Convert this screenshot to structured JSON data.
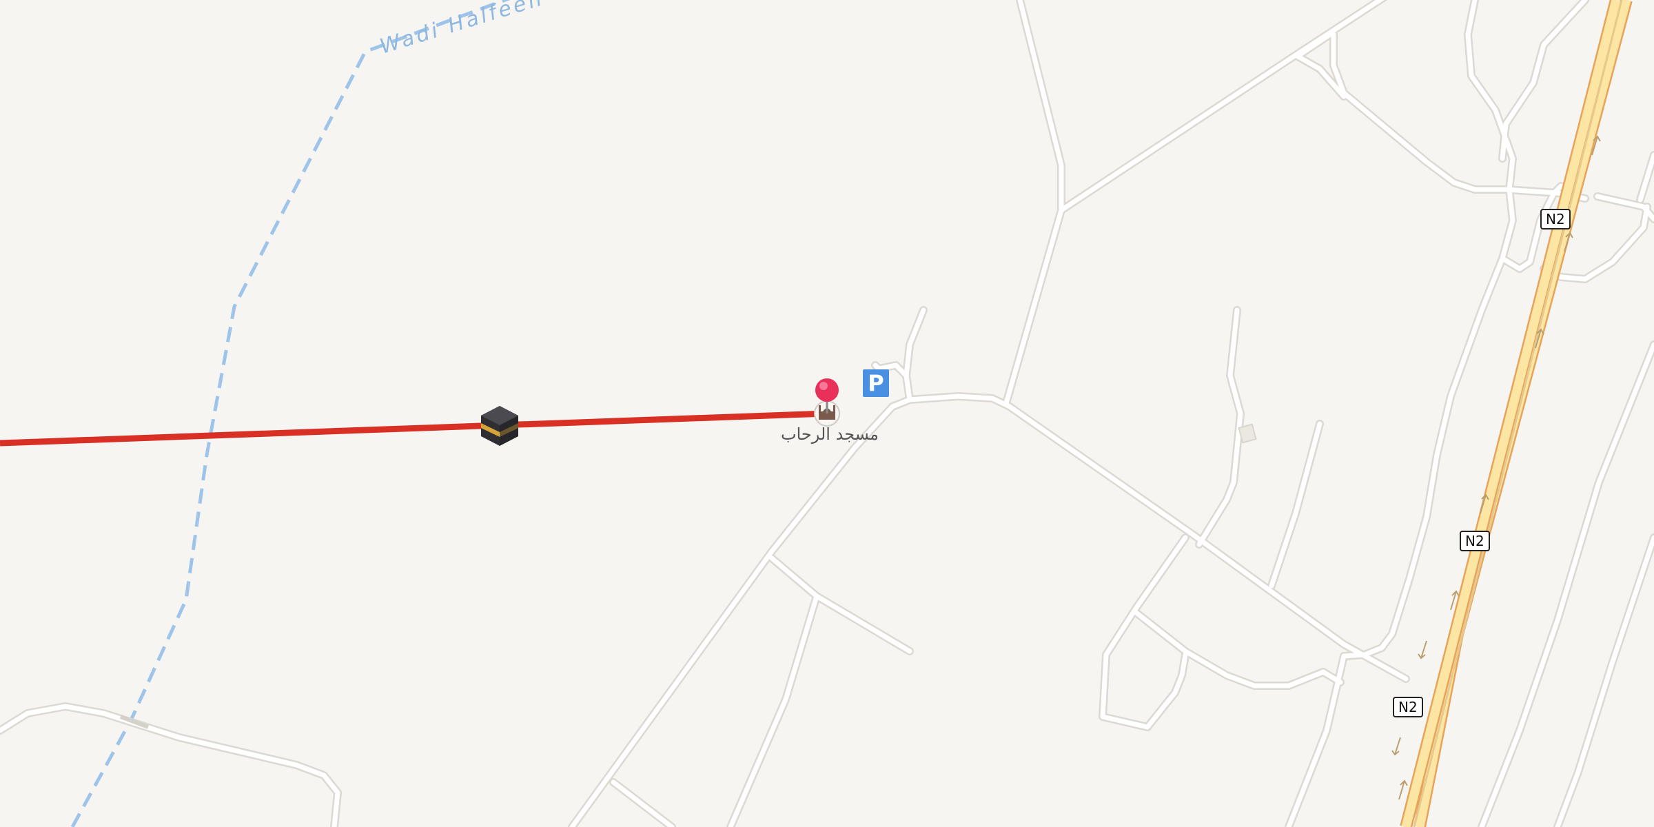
{
  "map": {
    "waterway": {
      "name": "Wadi Halfeen"
    },
    "highway_shields": [
      {
        "ref": "N2"
      },
      {
        "ref": "N2"
      },
      {
        "ref": "N2"
      }
    ],
    "poi": {
      "name": "مسجد الرحاب",
      "type": "mosque-icon"
    },
    "parking": {
      "label": "P"
    },
    "kaaba_marker": {
      "type": "kaaba-icon"
    },
    "pin": {
      "color": "#e8305a"
    },
    "qibla_line": {
      "color": "#d93025"
    },
    "colors": {
      "background": "#f7f5f2",
      "road": "#ffffff",
      "road_casing": "#dcd8d2",
      "highway_fill": "#fde6a3",
      "highway_casing": "#e8a35a",
      "waterway": "#9ec4ea"
    }
  }
}
